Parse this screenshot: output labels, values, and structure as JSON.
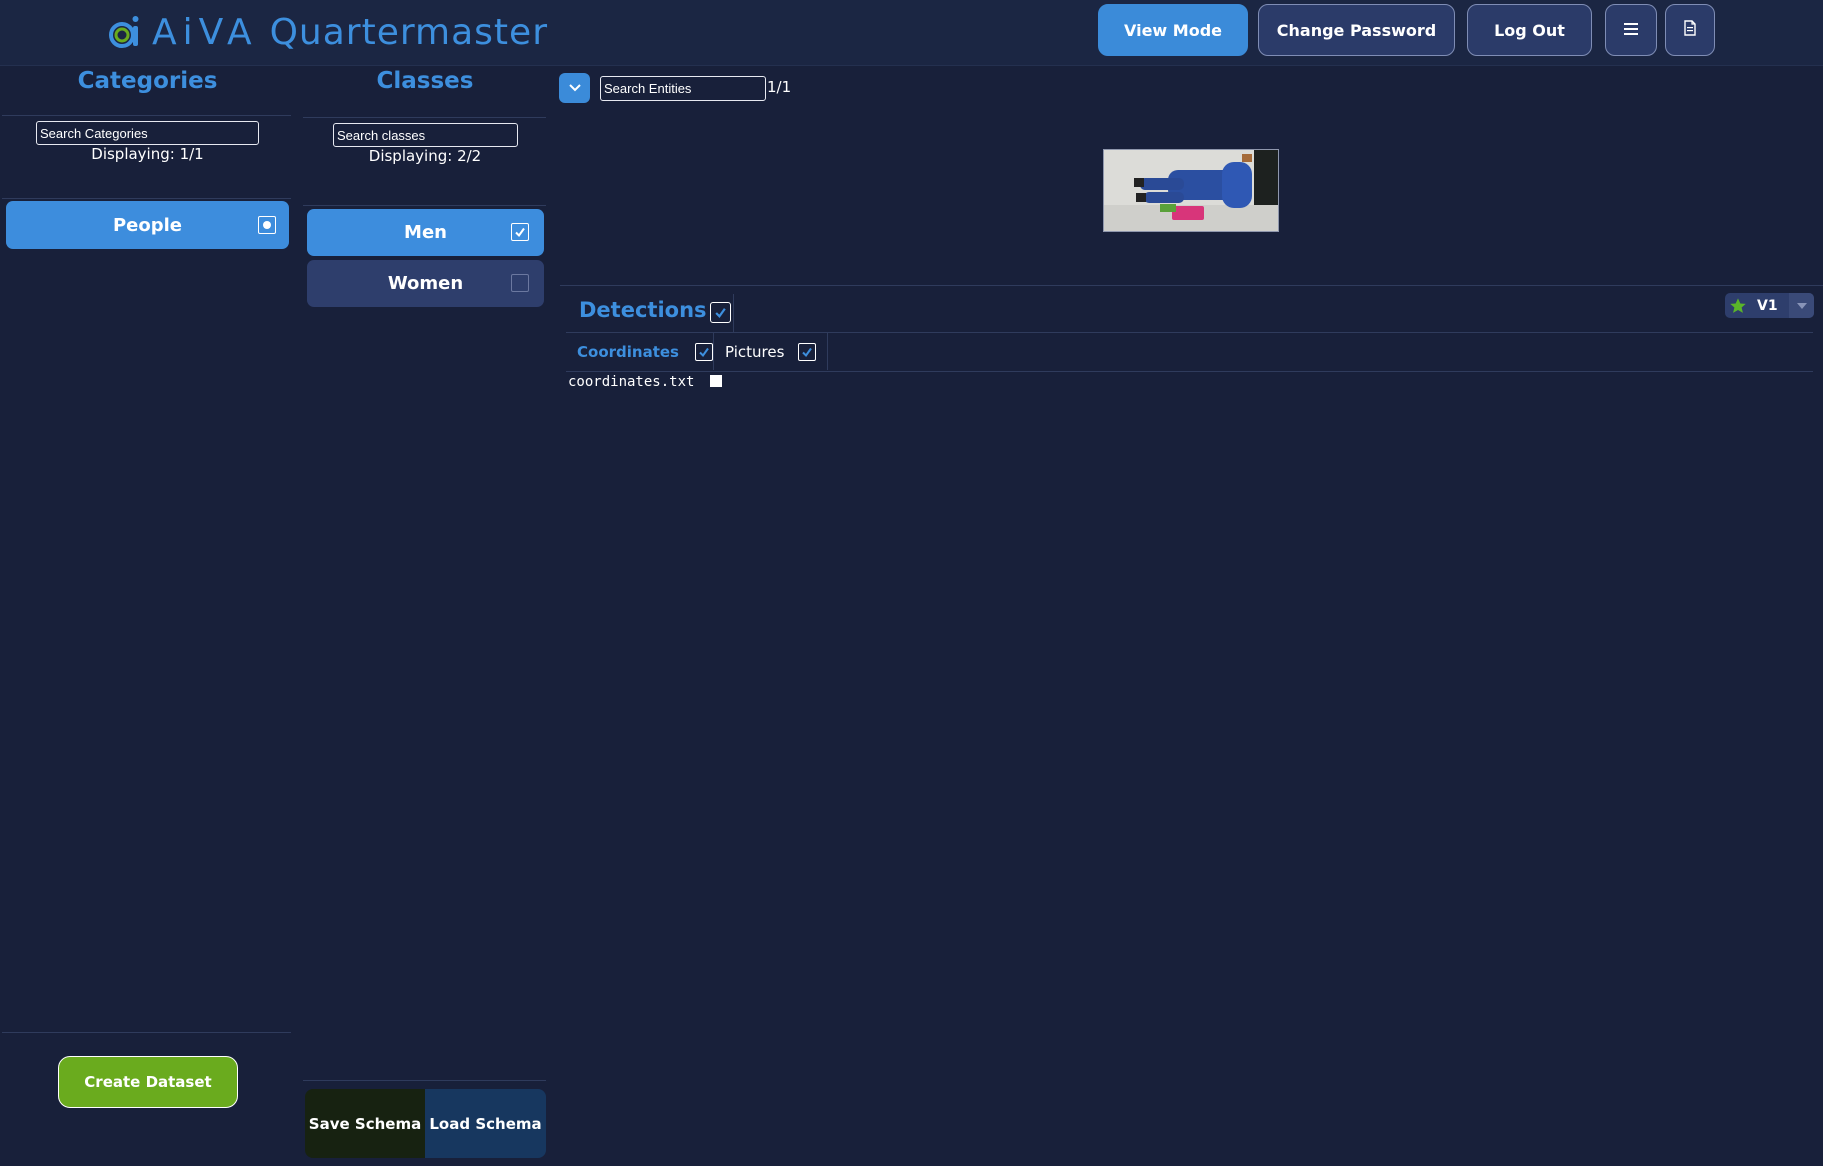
{
  "app": {
    "brand_name": "AiVA",
    "product_name": "Quartermaster"
  },
  "header": {
    "view_mode_label": "View Mode",
    "change_password_label": "Change Password",
    "log_out_label": "Log Out",
    "menu_icon": "hamburger-icon",
    "doc_icon": "document-icon"
  },
  "categories": {
    "title": "Categories",
    "search_placeholder": "Search Categories",
    "displaying": "Displaying: 1/1",
    "items": [
      {
        "label": "People",
        "selected": true
      }
    ],
    "create_dataset_label": "Create Dataset"
  },
  "classes": {
    "title": "Classes",
    "search_placeholder": "Search classes",
    "displaying": "Displaying: 2/2",
    "items": [
      {
        "label": "Men",
        "checked": true
      },
      {
        "label": "Women",
        "checked": false
      }
    ],
    "save_schema_label": "Save Schema",
    "load_schema_label": "Load Schema"
  },
  "entities": {
    "search_placeholder": "Search Entities",
    "count": "1/1"
  },
  "detections": {
    "title": "Detections",
    "checked": true,
    "tabs": [
      {
        "label": "Coordinates",
        "active": true,
        "checked": true
      },
      {
        "label": "Pictures",
        "active": false,
        "checked": true
      }
    ],
    "files": [
      {
        "name": "coordinates.txt",
        "checked": false
      }
    ],
    "version": "V1"
  },
  "colors": {
    "background": "#18203a",
    "header": "#1b2643",
    "accent": "#3d8fde",
    "selected_item": "#3d8ddd",
    "unselected_item": "#2e3e6c",
    "create_button": "#6aab1e",
    "save_button": "#172211",
    "load_button": "#17375f",
    "version_star": "#5ab52a"
  }
}
